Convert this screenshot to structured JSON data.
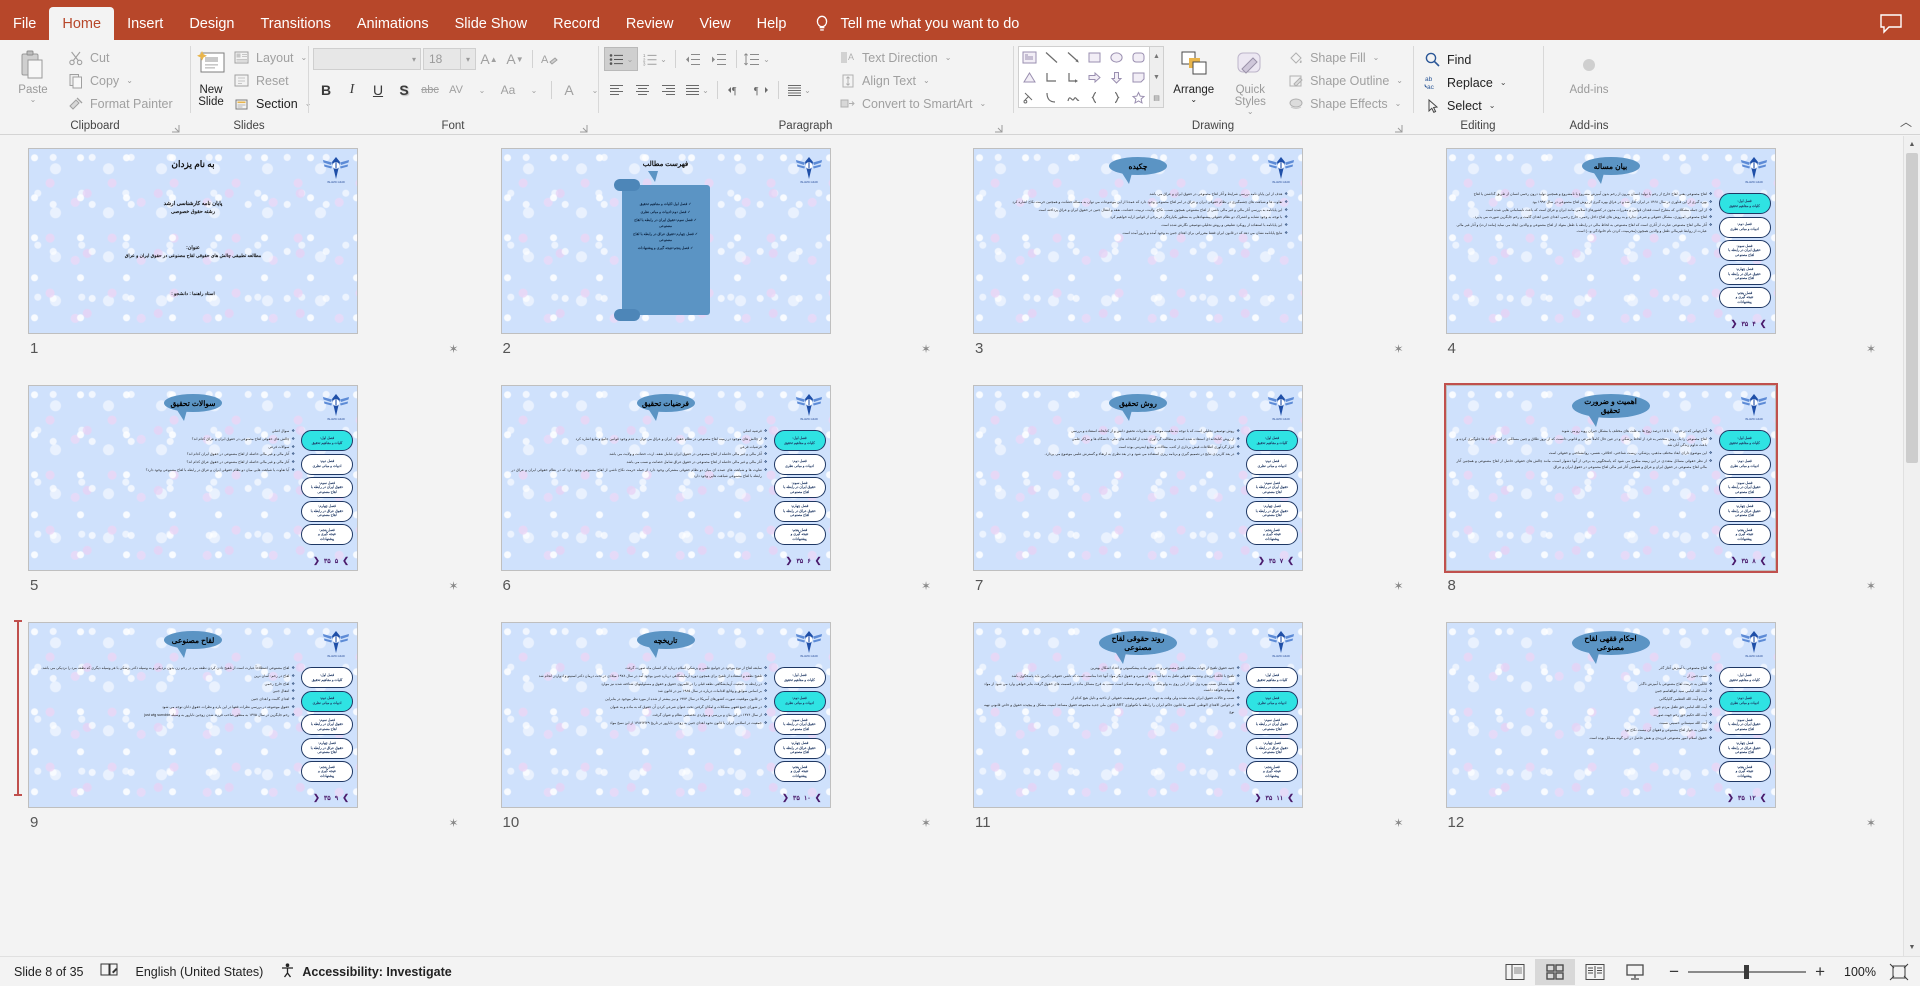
{
  "app": {
    "tabs": [
      {
        "label": "File",
        "active": false
      },
      {
        "label": "Home",
        "active": true
      },
      {
        "label": "Insert",
        "active": false
      },
      {
        "label": "Design",
        "active": false
      },
      {
        "label": "Transitions",
        "active": false
      },
      {
        "label": "Animations",
        "active": false
      },
      {
        "label": "Slide Show",
        "active": false
      },
      {
        "label": "Record",
        "active": false
      },
      {
        "label": "Review",
        "active": false
      },
      {
        "label": "View",
        "active": false
      },
      {
        "label": "Help",
        "active": false
      }
    ],
    "tell_me": "Tell me what you want to do"
  },
  "ribbon": {
    "clipboard": {
      "label": "Clipboard",
      "paste": "Paste",
      "cut": "Cut",
      "copy": "Copy",
      "format_painter": "Format Painter"
    },
    "slides": {
      "label": "Slides",
      "new_slide": "New Slide",
      "layout": "Layout",
      "reset": "Reset",
      "section": "Section"
    },
    "font": {
      "label": "Font",
      "font_name": "",
      "font_size": "18",
      "bold": "B",
      "italic": "I",
      "underline": "U",
      "shadow": "S",
      "strikethrough": "abc",
      "char_spacing": "AV",
      "change_case": "Aa",
      "font_color": "A"
    },
    "paragraph": {
      "label": "Paragraph",
      "text_direction": "Text Direction",
      "align_text": "Align Text",
      "convert_to_smartart": "Convert to SmartArt"
    },
    "drawing": {
      "label": "Drawing",
      "arrange": "Arrange",
      "quick_styles": "Quick Styles",
      "shape_fill": "Shape Fill",
      "shape_outline": "Shape Outline",
      "shape_effects": "Shape Effects"
    },
    "editing": {
      "label": "Editing",
      "find": "Find",
      "replace": "Replace",
      "select": "Select"
    },
    "addins": {
      "label": "Add-ins",
      "button": "Add-ins"
    }
  },
  "nav_buttons": [
    {
      "l1": "فصل اول:",
      "l2": "کلیات و مفاهیم تحقیق"
    },
    {
      "l1": "فصل دوم:",
      "l2": "ادبیات و مبانی نظری"
    },
    {
      "l1": "فصل سوم:",
      "l2": "حقوق ایران در رابطه با",
      "l3": "لقاح مصنوعی"
    },
    {
      "l1": "فصل چهارم:",
      "l2": "حقوق عراق در رابطه با",
      "l3": "لقاح مصنوعی"
    },
    {
      "l1": "فصل پنجم:",
      "l2": "نتیجه گیری و",
      "l3": "پیشنهادات"
    }
  ],
  "slides": [
    {
      "number": "1",
      "kind": "title",
      "bismillah": "به نام یزدان",
      "lines": [
        "پایان نامه کارشناسی ارشد",
        "رشته حقوق خصوصی",
        "عنوان:",
        "مطالعه تطبیقی چالش های حقوقی لقاح مصنوعی در حقوق ایران و عراق",
        "استاد راهنما :                        دانشجو :"
      ],
      "selected": false,
      "active_nav": -1
    },
    {
      "number": "2",
      "kind": "toc",
      "title": "فهرست مطالب",
      "items": [
        "فصل اول:کلیات و مفاهیم تحقیق",
        "فصل دوم:ادبیات و مبانی نظری",
        "فصل سوم:حقوق ایران در رابطه با لقاح مصنوعی",
        "فصل چهارم:حقوق عراق در رابطه با لقاح مصنوعی",
        "فصل پنجم:نتیجه گیری و پیشنهادات"
      ],
      "selected": false,
      "active_nav": -1
    },
    {
      "number": "3",
      "kind": "content",
      "title": "چکیده",
      "show_nav": false,
      "show_pager": false,
      "bullets": [
        "هدف از این پایان نامه بررسی شرایط و آثار لقاح مصنوعی در حقوق ایران و عراق می باشد",
        "تفاوت ها و شباهت های چشمگیری در نظام حقوقی ایران و عراق در امر لقاح مصنوعی وجود دارد که عمدتا از این موضوعات می توان به مساله حضانت و همچنین حرمت نکاح اشاره کرد",
        "این پایانامه به بررسی آثار مالی و غیر مالی ناشی از لقاح مصنوعی همچون نسب، نکاح، ولایت، تربیت، حضانت، نفقه و انتقال جنین در حقوق ایران و عراق پرداخته است",
        "با توجه به وجود تشابه و اشتراک دو نظام حقوقی پیشنهادهایی به منظور یکپارچگی در برخی از قوانین ارایه خواهیم کرد",
        "این پایانامه با استفاده از رویکرد تطبیقی و روش تحلیلی-توصیفی نگارش شده است",
        "نتایج پایانامه نشان می دهد که در قانون ایران فقط مقرراتی برای اهدای جنین به وجود آمده و بارور آمده است"
      ],
      "selected": false,
      "active_nav": -1
    },
    {
      "number": "4",
      "kind": "content",
      "title": "بیان مساله",
      "show_nav": true,
      "show_pager": true,
      "pager_cur": "۴",
      "pager_tot": "۳۵",
      "active_nav": 0,
      "bullets": [
        "لقاح مصنوعی یعنی لقاح خارج از رحم یا تولید انسان بیرون از رحم بدون آمیزش مشروع یا نامشروع و همچنین تولید درون رحمی انسان از طریق گذاشتن یا لقاح",
        "بهره گیری از این فناوری در سال ۱۳۶۸ در ایران آغاز شد و در عراق بهره گیری از روش لقاح مصنوعی در سال ۱۹۹۲ بود",
        "از این جمله مشکلاتی که مطرح است فقدان قوانین و مقررات مدون در کشورهای اسلامی مانند ایران و عراق است که باعث نابسامانی هایی شده است",
        "لقاح مصنوعی امروزی، مشکل حقوقی و شرعی ندارد و به روش های لقاح داخل رحمی، خارج رحمی، اهدای جنین اهدای گامت و رحم جایگزین صورت می پذیرد .",
        "آثار مالی لقاح مصنوعی عبارت از آثاری است که لقاح مصنوعی به لحاظ مالی در رابطه با طفل متولد از لقاح مصنوعی و والدین ایجاد می نماید (مانند ارث) و آثار غیر مالی عبارت از روابط غیرمالی طفل و والدین همچون (محرمیت، کردن نام خانوادگی و...) است."
      ],
      "selected": false
    },
    {
      "number": "5",
      "kind": "content",
      "title": "سوالات تحقیق",
      "show_nav": true,
      "show_pager": true,
      "pager_cur": "۵",
      "pager_tot": "۳۵",
      "active_nav": 0,
      "bullets": [
        "سوال اصلی",
        "چالش های حقوقی لقاح مصنوعی در حقوق ایران و عراق کدام اند؟",
        "سوالات فرعی",
        "آثار مالی و غیر مالی حاصله از لقاح مصنوعی در حقوق ایران کدام اند؟",
        "آثار مالی و غیر مالی حاصله از لقاح مصنوعی در حقوق عراق کدام اند؟",
        "آیا تفاوت یا شباهت هایی میان دو نظام حقوقی ایران و عراق در رابطه با لقاح مصنوعی وجود دارد؟"
      ],
      "selected": false
    },
    {
      "number": "6",
      "kind": "content",
      "title": "فرضیات تحقیق",
      "show_nav": true,
      "show_pager": true,
      "pager_cur": "۶",
      "pager_tot": "۳۵",
      "active_nav": 0,
      "bullets": [
        "فرضیه اصلی",
        "از چالش های موجود در زمینه لقاح مصنوعی در نظام حقوقی ایران و عراق می توان به عدم وجود قوانین جامع و مانع اشاره کرد",
        "فرضیات فرعی",
        "آثار مالی و غیر مالی حاصله از لقاح مصنوعی در حقوق ایران شامل نفقه، ارث، حضانت و ولایت می باشد",
        "آثار مالی و غیر مالی حاصله از لقاح مصنوعی در حقوق عراق شامل حضانت و نسب می باشد",
        "تفاوت ها و شباهت های عمده ای میان دو نظام حقوقی مشترکی وجود دارد از جمله حرمت نکاح ناشی از لقاح مصنوعی وجود دارد که در نظام حقوقی ایران و عراق در رابطه با لقاح مصنوعی شباهت هایی وجود دارد"
      ],
      "selected": false
    },
    {
      "number": "7",
      "kind": "content",
      "title": "روش تحقیق",
      "show_nav": true,
      "show_pager": true,
      "pager_cur": "۷",
      "pager_tot": "۳۵",
      "active_nav": 0,
      "bullets": [
        "روش توصیفی تحلیلی است که با توجه به ماهیت موضوع به نظریات تحقیق دانش و از کتابخانه استفاده و بررسی",
        "از روش کتابخانه ای استفاده شده است و مطالب گردآوری شده از کتابخانه های ملی، دانشگاه ها و مراکز علمی",
        "ابزار گردآوری اطلاعات فیش برداری از کتب، مقالات و منابع اینترنتی بوده است",
        "در بعد کاربردی نتایج در تصمیم گیری و برنامه ریزی استفاده می شود و در بعد نظری به ارتقاء و گسترش علمی موضوع می پردازد."
      ],
      "selected": false
    },
    {
      "number": "8",
      "kind": "content",
      "title": "اهمیت و ضرورت تحقیق",
      "show_nav": true,
      "show_pager": true,
      "pager_cur": "۸",
      "pager_tot": "۳۵",
      "active_nav": 0,
      "bullets": [
        "آمارجهانی که در حدود ۱۰ تا ۱۵ درصد زوج ها به علت های مختلف با مشکل جبران رویه رو می شوند",
        "لقاح مصنوعی را یک روش منحصر به فرد از لحاظ پزشکی و در عین حال کاملاً شرعی و قانونی دانست که از بروز طلاق و چنین مسائلی در این خانواده ها جلوگیری کرده و باعث تداوم زندگی آنان شد",
        "این موضوع دارای ابعاد مختلف مذهبی، پزشکی، زیست شناختی، اخلاقی، نفسی، روانشناختی و حقوقی است",
        "از نظر حقوقی مسائل متعددی در این زمینه مطرح می شود که پاسخگویی به برخی از آنها دشوار است، مانند چالش های حقوقی حاصل از لقاح مصنوعی و همچنین آثار مالی لقاح مصنوعی در حقوق ایران و عراق و همچنین آثار غیر مالی لقاح مصنوعی در حقوق ایران و عراق"
      ],
      "selected": true
    },
    {
      "number": "9",
      "kind": "content",
      "title": "لقاح مصنوعی",
      "show_nav": true,
      "show_pager": true,
      "pager_cur": "۹",
      "pager_tot": "۳۵",
      "active_nav": 1,
      "bullets": [
        "لقاح مصنوعی اصطلاحاً عبارت است از تلقیح دادن کردن نطفه مرد در رحم زن بدون نزدیکی و به وسیله دکتر پزشکی با هر وسیله دیگری که نطفه مرد را نزدیکی می باشد.",
        "لقاح در رحم: آسان ترین",
        "لقاح خارج رحمی",
        "انتقال جنین",
        "اهدای گامت و اهدای جنین",
        "حقوق موضوعه در بررسی نظرات فقها در این باره و نظرات حقوق دانان توجه می شود",
        "رحم جایگزین در سال ۱۳۷۵ به منظور صاحب فرزند شدن زوجین نابارور به وسیله just wlg surrobin"
      ],
      "selected": false
    },
    {
      "number": "10",
      "kind": "content",
      "title": "تاریخچه",
      "show_nav": true,
      "show_pager": true,
      "pager_cur": "۱۰",
      "pager_tot": "۳۵",
      "active_nav": 1,
      "bullets": [
        "سابقه لقاح از نوع موجود در جوامع علمی و پزشکی اسلام درباره کار انسان ماه صورت گرفت",
        "تلقیح نطفه و استفاده از تلقیح برای همچون دوره آزمایشگاهی درباره جنین بوجود آمد در سال ۱۹۷۸ میلادی در تحت درمان دکتر استپتو و ادواردز انجام شد",
        "در رابطه به جمعیت آزمایشگاهی نطفه قبلی را در قلمروی حقوق و حقوق و مسئولیتهای شناخته شده نیز موارد",
        "بر اساس سوابق و وقایع اقدامات درباره در سال ۱۹۸۵ نیز در قانون شد",
        "در قانون موقعیت صورت کشورهای آمریکا در سال ۱۹۷۳ و نیز بیشتر از شده از مورد نظر موجود در بنابراین",
        "در شورای جمع فقهی مشکلات و امکان گرفتن تحت عنوان شرعی کردن آن حقوق که به ماده و به عنوان",
        "از سال ۱۳۷۶ در این بیان و بررسی و مواردی تخصصی نظام و عنوان گرفت",
        "جمعیت در اسلامی ایران با قانون نحوه اهدای جنین به زوجین نابارور در تاریخ ۱۳۸۲/۴/۲۹ از این نسخ مواد"
      ],
      "selected": false
    },
    {
      "number": "11",
      "kind": "content",
      "title": "روند حقوقی لقاح مصنوعی",
      "show_nav": true,
      "show_pager": true,
      "pager_cur": "۱۱",
      "pager_tot": "۳۵",
      "active_nav": 1,
      "bullets": [
        "جنبه حقوق تلقیح از جهات مختلف تلقیح مصنوعی و خصوص ماده پیشکسوتی و اعداد اشکال بهترین",
        "تلقیح با قائله فرزندی وضعیت حقوقی طفل به دنیا آمده و حق شیره و حقوق دیگر مواد آنها جدا مناسب است که ناشی حقوقی دکترین باید پاسخگوی باشد",
        "کلیه مسائل نسب بهره وی این از این روی به ولو ینکه و ربات و مواد مسکن است نسب به فرح مسائل ماده در قسمت های حقوق گرفت بنابر خواهی وارد می شود از مواد و ابهام نخواهد داشت",
        "نسب و حالات حقوق ایران بحث نشده ولی وقت به جهت در خصوص وضعیت حقوقی از ناحیه و دلیل هیچ کدام از",
        "در قوانین الاهدای الوطنی کشور ما قانون حاکم ایران را رابطه با تکنولوژی ART قانون ملی جدید مجموعه حقوق مساعد امنیت مشکل و پیچیده حقوق و خاص قانونی تهیه نوع"
      ],
      "selected": false
    },
    {
      "number": "12",
      "kind": "content",
      "title": "احکام فقهی لقاح مصنوعی",
      "show_nav": true,
      "show_pager": true,
      "pager_cur": "۱۲",
      "pager_tot": "۳۵",
      "active_nav": 1,
      "bullets": [
        "لقاح مصنوعی با آمیزش آغاز گذر",
        "نسب جنین از ...",
        "قائلین به حرمت لقاح مصنوعی با آمیزش ناگذر",
        "آیت الله امامی سید ابوالقاسم جنین",
        "مرجع آیت الله العظمی گلپایگانی",
        "آیت الله امامی حق طفل مردم جنین",
        "آیت الله حکیم حق رحم جهت صورت",
        "آیت الله سیستانی حسینی نسبت",
        "قائلین به جواز لقاح مصنوعی و فقهای آن نیست نکاح بود",
        "حقوق اسلام امور مصنوعی فرزندی و نقش حاصل در این گونه مسائل بوده است"
      ],
      "selected": false
    }
  ],
  "status": {
    "slide_of": "Slide 8 of 35",
    "language": "English (United States)",
    "accessibility": "Accessibility: Investigate",
    "zoom": "100%"
  }
}
